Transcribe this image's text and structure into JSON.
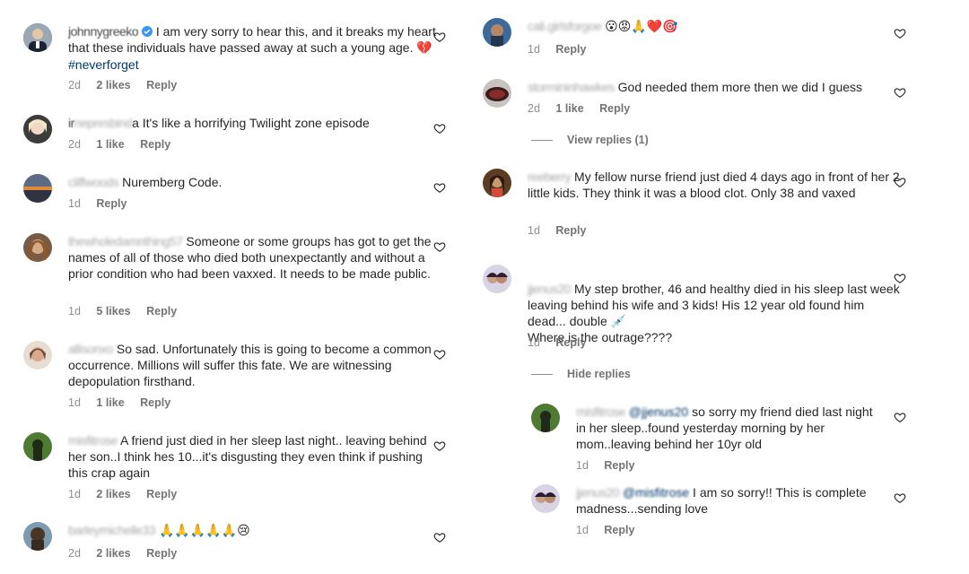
{
  "left_comments": [
    {
      "user": "johnnygreeko",
      "verified": true,
      "text": "I am very sorry to hear this, and it breaks my heart that these individuals have passed away at such a young age.",
      "emoji": "💔",
      "hashtag": "#neverforget",
      "age": "2d",
      "likes": "2 likes",
      "reply": "Reply",
      "avatar_color": "#2b3a55"
    },
    {
      "user": "irenepresbinda",
      "text": "It's like a horrifying Twilight zone episode",
      "age": "2d",
      "likes": "1 like",
      "reply": "Reply",
      "avatar_color": "#d9cfc4"
    },
    {
      "user": "cliffwoods",
      "text": "Nuremberg Code.",
      "age": "1d",
      "likes": "",
      "reply": "Reply",
      "avatar_color": "#c9763a"
    },
    {
      "user": "thewholedamnthing57",
      "text": "Someone or some groups has got to get the names of all of those who died both unexpectantly and without a prior condition who had been vaxxed. It needs to be made public.",
      "age": "1d",
      "likes": "5 likes",
      "reply": "Reply",
      "avatar_color": "#b5835e"
    },
    {
      "user": "allisonxo",
      "text": "So sad. Unfortunately this is going to become a common occurrence. Millions will suffer this fate. We are witnessing depopulation firsthand.",
      "age": "1d",
      "likes": "1 like",
      "reply": "Reply",
      "avatar_color": "#c8a58c"
    },
    {
      "user": "misfitrose",
      "text": "A friend just died in her sleep last night.. leaving behind her son..I think hes 10...it's disgusting they even think if pushing this crap again",
      "age": "1d",
      "likes": "2 likes",
      "reply": "Reply",
      "avatar_color": "#3e5a2a"
    },
    {
      "user": "barleymichelle33",
      "text": "🙏🙏🙏🙏🙏😢",
      "age": "2d",
      "likes": "2 likes",
      "reply": "Reply",
      "avatar_color": "#6d5a48"
    }
  ],
  "right_comments": [
    {
      "user": "cali.girlsforgoe",
      "text": "😮😡🙏❤️🎯",
      "age": "1d",
      "likes": "",
      "reply": "Reply",
      "avatar_color": "#4a6b8c"
    },
    {
      "user": "stormininhawkes",
      "text": "God needed them more then we did I guess",
      "age": "2d",
      "likes": "1 like",
      "reply": "Reply",
      "avatar_color": "#8a3b3b"
    },
    {
      "user": "reeberry",
      "text": "My fellow nurse friend just died 4 days ago in front of her 2 little kids. They think it was a blood clot. Only 38 and vaxed",
      "age": "1d",
      "likes": "",
      "reply": "Reply",
      "avatar_color": "#6b4a2e"
    },
    {
      "user": "jjenus20",
      "text": "My step brother, 46 and healthy died in his sleep last week leaving behind his wife and 3 kids! His 12 year old found him dead... double 💉\nWhere is the outrage????",
      "age": "1d",
      "likes": "",
      "reply": "Reply",
      "avatar_color": "#5e4c7a"
    }
  ],
  "replies": [
    {
      "user": "misfitrose",
      "mention": "@jjenus20",
      "text": "so sorry my friend died last night in her sleep..found yesterday morning by her mom..leaving behind her 10yr old",
      "age": "1d",
      "reply": "Reply",
      "avatar_color": "#3e5a2a"
    },
    {
      "user": "jjenus20",
      "mention": "@misfitrose",
      "text": "I am so sorry!! This is complete madness...sending love",
      "age": "1d",
      "reply": "Reply",
      "avatar_color": "#5e4c7a"
    }
  ],
  "view_replies_label": "View replies (1)",
  "hide_replies_label": "Hide replies"
}
